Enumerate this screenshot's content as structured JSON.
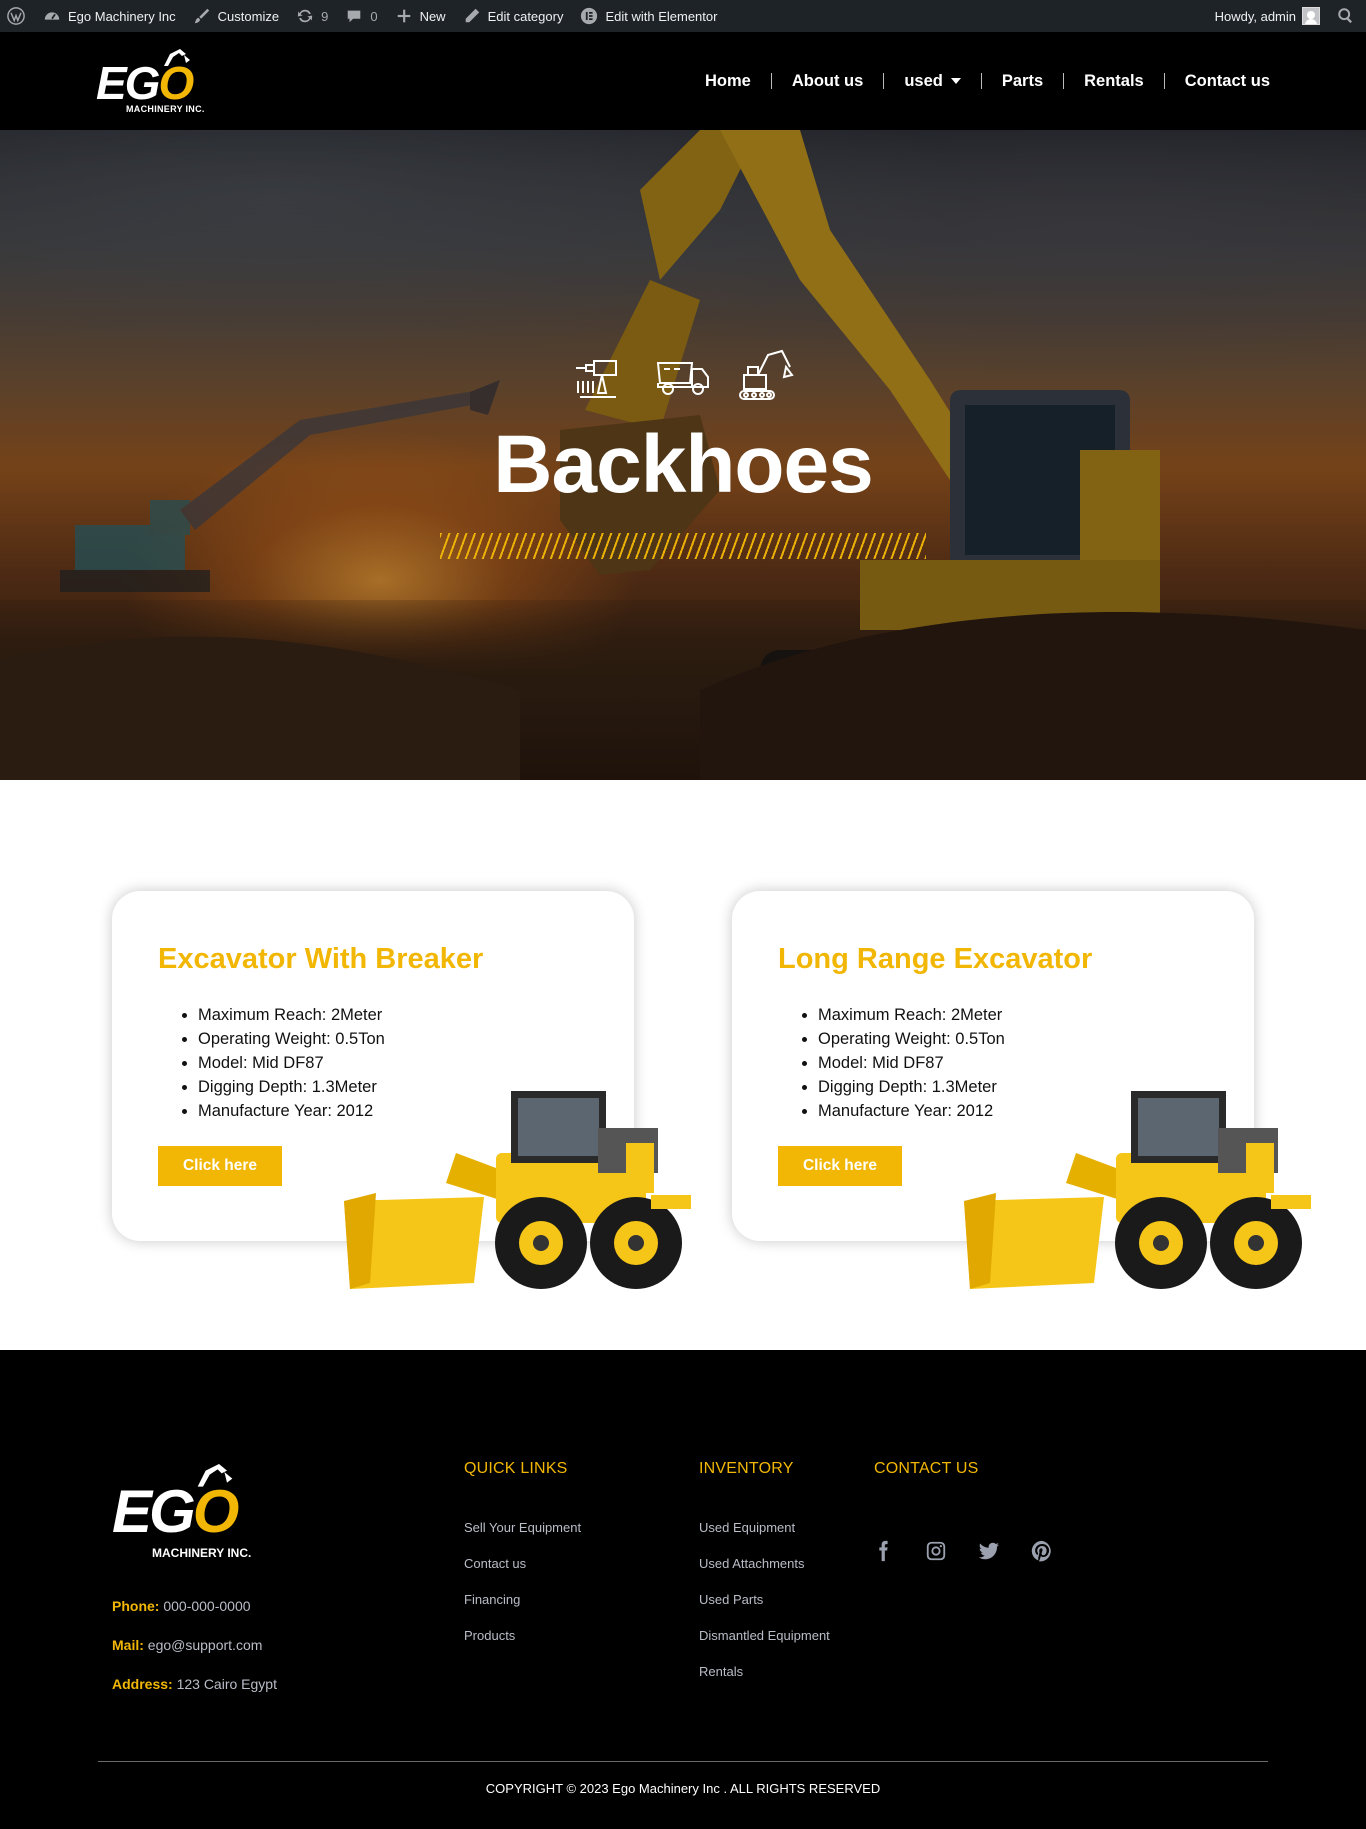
{
  "admin_bar": {
    "site_name": "Ego Machinery Inc",
    "customize": "Customize",
    "updates_count": "9",
    "comments_count": "0",
    "new": "New",
    "edit_category": "Edit category",
    "edit_elementor": "Edit with Elementor",
    "howdy": "Howdy, admin"
  },
  "header": {
    "logo": {
      "eg": "EG",
      "o": "O",
      "sub": "MACHINERY INC."
    },
    "nav": [
      {
        "label": "Home"
      },
      {
        "label": "About us"
      },
      {
        "label": "used"
      },
      {
        "label": "Parts"
      },
      {
        "label": "Rentals"
      },
      {
        "label": "Contact us"
      }
    ]
  },
  "hero": {
    "icons": [
      "drill-icon",
      "dump-truck-icon",
      "excavator-icon"
    ],
    "title": "Backhoes"
  },
  "products": [
    {
      "title": "Excavator With Breaker",
      "specs": [
        "Maximum Reach: 2Meter",
        "Operating Weight: 0.5Ton",
        "Model: Mid DF87",
        "Digging Depth: 1.3Meter",
        "Manufacture Year: 2012"
      ],
      "button": "Click here"
    },
    {
      "title": "Long Range Excavator",
      "specs": [
        "Maximum Reach: 2Meter",
        "Operating Weight: 0.5Ton",
        "Model: Mid DF87",
        "Digging Depth: 1.3Meter",
        "Manufacture Year: 2012"
      ],
      "button": "Click here"
    }
  ],
  "footer": {
    "logo": {
      "eg": "EG",
      "o": "O",
      "sub": "MACHINERY INC."
    },
    "contact": {
      "phone_label": "Phone:",
      "phone": "000-000-0000",
      "mail_label": "Mail:",
      "mail": "ego@support.com",
      "address_label": "Address:",
      "address": "123 Cairo Egypt"
    },
    "quick_links": {
      "heading": "QUICK LINKS",
      "items": [
        "Sell Your Equipment",
        "Contact us",
        "Financing",
        "Products"
      ]
    },
    "inventory": {
      "heading": "INVENTORY",
      "items": [
        "Used Equipment",
        "Used Attachments",
        "Used Parts",
        "Dismantled Equipment",
        "Rentals"
      ]
    },
    "contact_us": {
      "heading": "CONTACT US",
      "social": [
        "facebook-icon",
        "instagram-icon",
        "twitter-icon",
        "pinterest-icon"
      ]
    },
    "copyright": "COPYRIGHT © 2023 Ego Machinery Inc . ALL RIGHTS RESERVED"
  },
  "colors": {
    "accent": "#f2b705",
    "header_bg": "#000000",
    "admin_bar_bg": "#1d2327",
    "footer_link": "#b9bdc7"
  }
}
